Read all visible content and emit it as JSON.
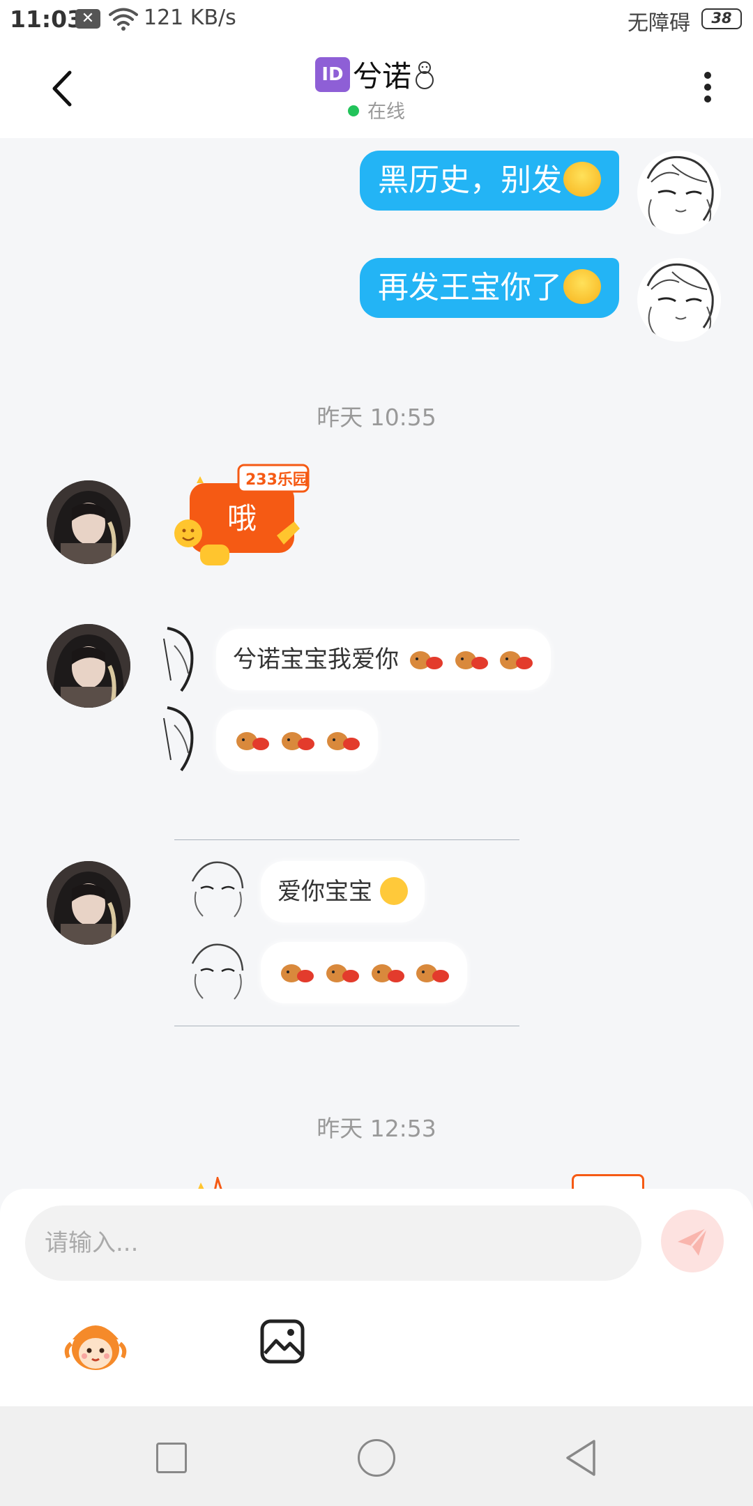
{
  "status_bar": {
    "time": "11:03",
    "network_speed": "121 KB/s",
    "accessibility_label": "无障碍",
    "battery": "38"
  },
  "header": {
    "id_badge": "ID",
    "title": "兮诺",
    "online_status": "在线"
  },
  "messages": [
    {
      "side": "right",
      "text": "黑历史，别发"
    },
    {
      "side": "right",
      "text": "再发王宝你了"
    }
  ],
  "time_labels": [
    "昨天 10:55",
    "昨天 12:53"
  ],
  "sticker": {
    "brand": "233乐园",
    "text": "哦"
  },
  "screenshot_one": {
    "line1": "兮诺宝宝我爱你"
  },
  "screenshot_two": {
    "line1": "爱你宝宝"
  },
  "input": {
    "placeholder": "请输入..."
  },
  "colors": {
    "bubble_self": "#23b4f5",
    "online": "#22c35a",
    "send_disabled": "#fde2e0",
    "sticker_orange": "#f55a14"
  }
}
